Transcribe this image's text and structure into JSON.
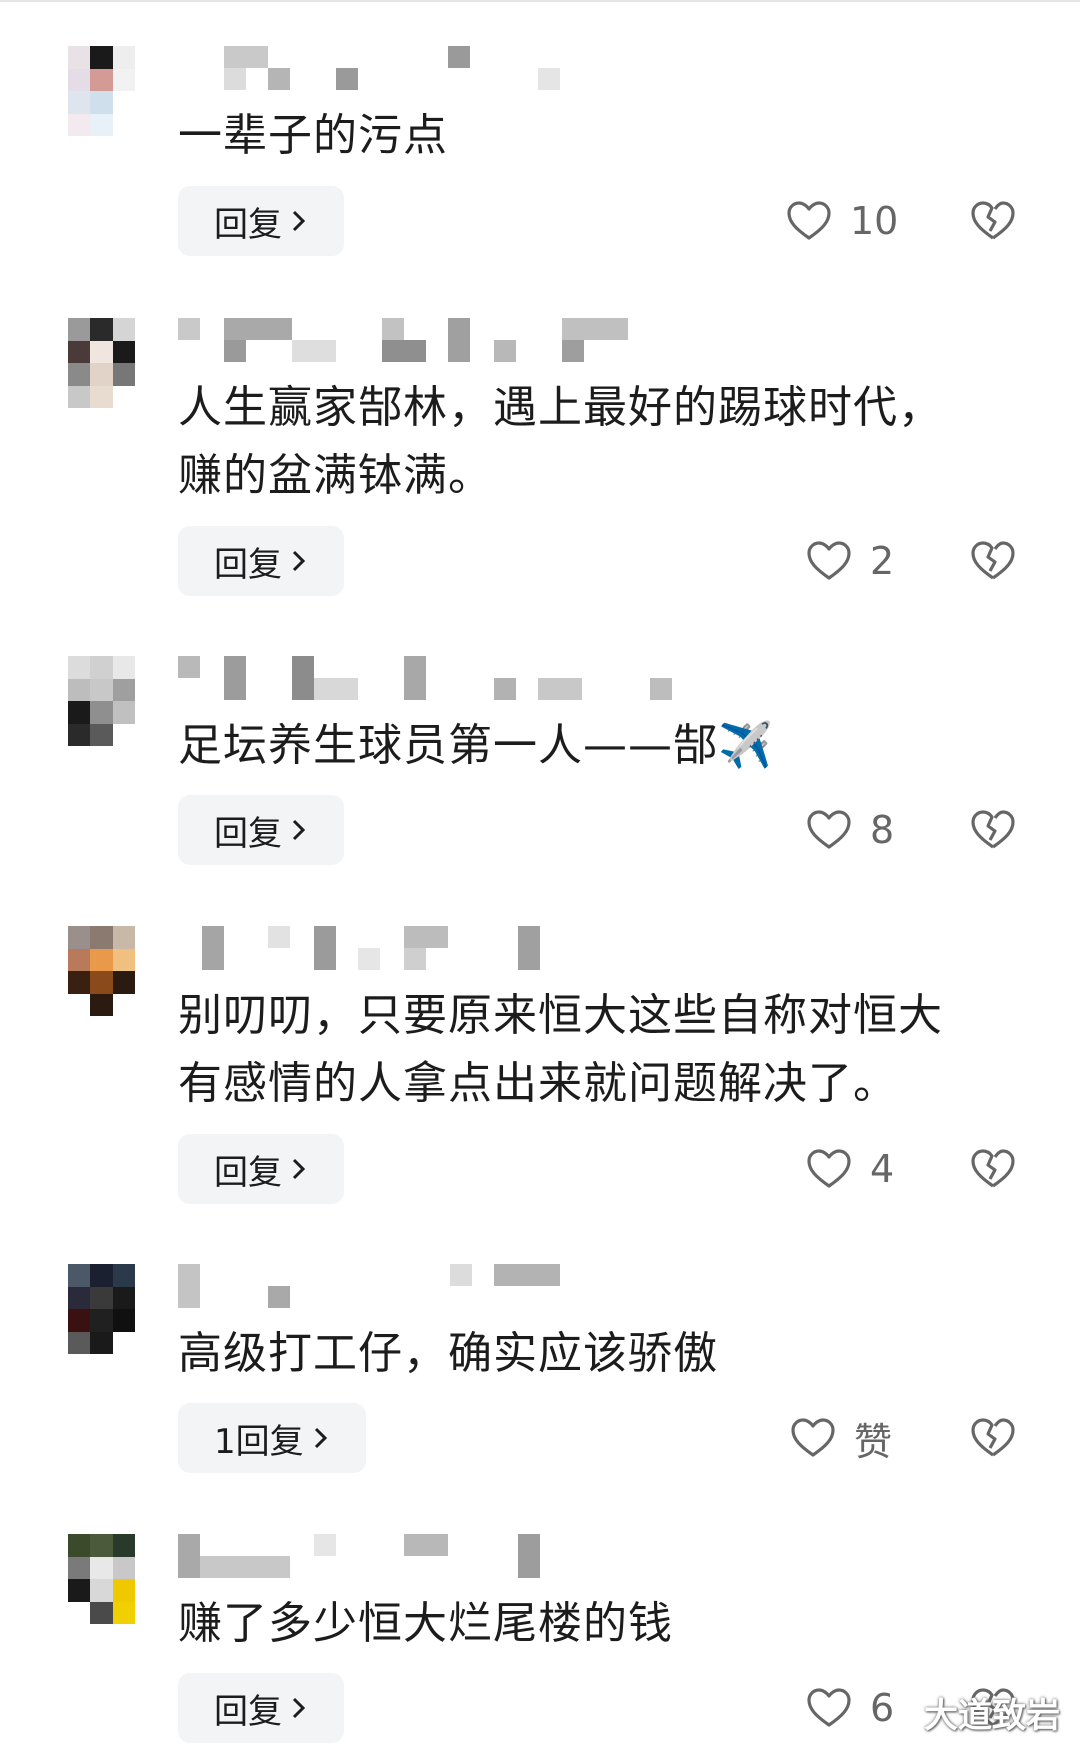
{
  "comments": [
    {
      "text_lines": [
        "一辈子的污点"
      ],
      "reply_label": "回复",
      "like_count": "10"
    },
    {
      "text_lines": [
        "人生赢家郜林，遇上最好的踢球时代，",
        "赚的盆满钵满。"
      ],
      "reply_label": "回复",
      "like_count": "2"
    },
    {
      "text_lines": [
        "足坛养生球员第一人——郜✈️"
      ],
      "reply_label": "回复",
      "like_count": "8"
    },
    {
      "text_lines": [
        "别叨叨，只要原来恒大这些自称对恒大",
        "有感情的人拿点出来就问题解决了。"
      ],
      "reply_label": "回复",
      "like_count": "4"
    },
    {
      "text_lines": [
        "高级打工仔，确实应该骄傲"
      ],
      "reply_label": "1回复",
      "like_count": "赞"
    },
    {
      "text_lines": [
        "赚了多少恒大烂尾楼的钱"
      ],
      "reply_label": "回复",
      "like_count": "6"
    }
  ],
  "icons": {
    "like": "heart-outline-icon",
    "dislike": "broken-heart-icon",
    "chevron": "chevron-right-icon"
  },
  "watermark": "大道致岩",
  "colors": {
    "text": "#1c1c1c",
    "reply_bg": "#f3f4f5",
    "icon": "#666666"
  }
}
